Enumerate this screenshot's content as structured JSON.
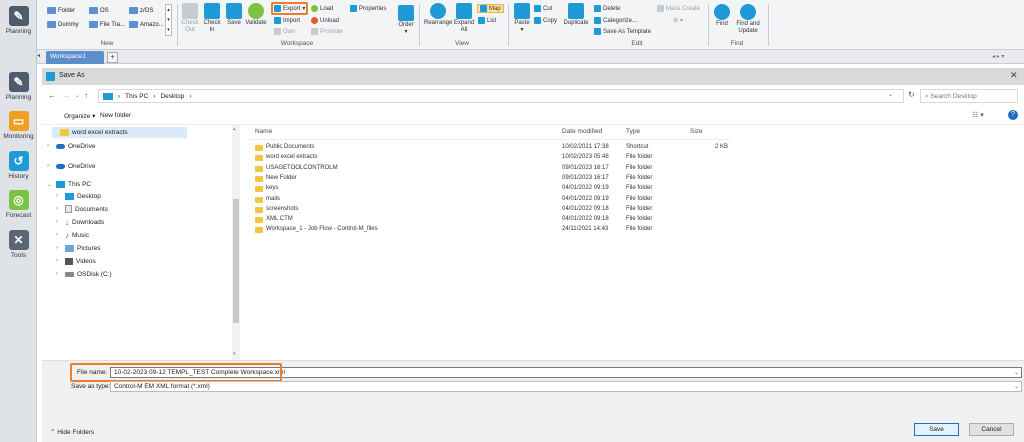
{
  "nav": {
    "items": [
      {
        "label": "Planning",
        "color": "#4e5c6e",
        "icon": "planning-icon"
      },
      {
        "label": "Monitoring",
        "color": "#f0a020",
        "icon": "monitoring-icon"
      },
      {
        "label": "History",
        "color": "#1e9ad6",
        "icon": "history-icon"
      },
      {
        "label": "Forecast",
        "color": "#7cc242",
        "icon": "forecast-icon"
      },
      {
        "label": "Tools",
        "color": "#5b6675",
        "icon": "tools-icon"
      }
    ],
    "top_label": "Planning"
  },
  "ribbon": {
    "new_items": [
      "Folder",
      "OS",
      "z/OS",
      "Dummy",
      "File Tra...",
      "Amazo..."
    ],
    "new_group": "New",
    "workspace": {
      "label": "Workspace",
      "check_out": "Check Out",
      "check_in": "Check In",
      "save": "Save",
      "validate": "Validate",
      "export": "Export",
      "import": "Import",
      "own": "Own",
      "load": "Load",
      "unload": "Unload",
      "promote": "Promote",
      "properties": "Properties",
      "order": "Order"
    },
    "view": {
      "label": "View",
      "rearrange": "Rearrange",
      "expand_all": "Expand All",
      "map": "Map",
      "list": "List"
    },
    "edit": {
      "label": "Edit",
      "paste": "Paste",
      "cut": "Cut",
      "copy": "Copy",
      "duplicate": "Duplicate",
      "delete": "Delete",
      "categorize": "Categorize...",
      "save_as_template": "Save As Template",
      "mass_create": "Mass Create"
    },
    "find": {
      "label": "Find",
      "find": "Find",
      "find_update": "Find and Update"
    }
  },
  "tabbar": {
    "tab": "Workspace1",
    "add": "+"
  },
  "dialog": {
    "title": "Save As",
    "address": {
      "this_pc": "This PC",
      "desktop": "Desktop",
      "search_placeholder": "Search Desktop"
    },
    "cmd": {
      "organize": "Organize",
      "new_folder": "New folder"
    },
    "tree": [
      {
        "label": "word excel extracts",
        "type": "folder",
        "indent": 0,
        "chev": ""
      },
      {
        "label": "OneDrive",
        "type": "cloud",
        "indent": 0,
        "chev": ">"
      },
      {
        "label": "OneDrive",
        "type": "cloud",
        "indent": 0,
        "chev": ">"
      },
      {
        "label": "This PC",
        "type": "pc",
        "indent": 0,
        "chev": "v"
      },
      {
        "label": "Desktop",
        "type": "desktop",
        "indent": 1,
        "chev": ">"
      },
      {
        "label": "Documents",
        "type": "docs",
        "indent": 1,
        "chev": ">"
      },
      {
        "label": "Downloads",
        "type": "down",
        "indent": 1,
        "chev": ">"
      },
      {
        "label": "Music",
        "type": "music",
        "indent": 1,
        "chev": ">"
      },
      {
        "label": "Pictures",
        "type": "pics",
        "indent": 1,
        "chev": ">"
      },
      {
        "label": "Videos",
        "type": "video",
        "indent": 1,
        "chev": ">"
      },
      {
        "label": "OSDisk (C:)",
        "type": "disk",
        "indent": 1,
        "chev": ">"
      }
    ],
    "columns": {
      "name": "Name",
      "date": "Date modified",
      "type": "Type",
      "size": "Size"
    },
    "files": [
      {
        "name": "Public Documents",
        "date": "10/02/2021 17:38",
        "type": "Shortcut",
        "size": "2 KB"
      },
      {
        "name": "word excel extracts",
        "date": "10/02/2023 05:48",
        "type": "File folder",
        "size": ""
      },
      {
        "name": "USAGETOOLCONTROLM",
        "date": "09/01/2023 16:17",
        "type": "File folder",
        "size": ""
      },
      {
        "name": "New Folder",
        "date": "09/01/2023 16:17",
        "type": "File folder",
        "size": ""
      },
      {
        "name": "keys",
        "date": "04/01/2022 09:19",
        "type": "File folder",
        "size": ""
      },
      {
        "name": "mails",
        "date": "04/01/2022 09:19",
        "type": "File folder",
        "size": ""
      },
      {
        "name": "screenshots",
        "date": "04/01/2022 09:18",
        "type": "File folder",
        "size": ""
      },
      {
        "name": "XML CTM",
        "date": "04/01/2022 09:18",
        "type": "File folder",
        "size": ""
      },
      {
        "name": "Workspace_1 - Job Flow - Control-M_files",
        "date": "24/11/2021 14:43",
        "type": "File folder",
        "size": ""
      }
    ],
    "file_name_label": "File name:",
    "file_name_value": "10-02-2023 09-12 TEMPL_TEST Complete Workspace.xml",
    "save_type_label": "Save as type:",
    "save_type_value": "Control-M EM XML format (*.xml)",
    "hide_folders": "Hide Folders",
    "save": "Save",
    "cancel": "Cancel"
  },
  "colors": {
    "accent": "#1e9ad6",
    "highlight": "#f07b2b",
    "folder": "#f5c542"
  }
}
